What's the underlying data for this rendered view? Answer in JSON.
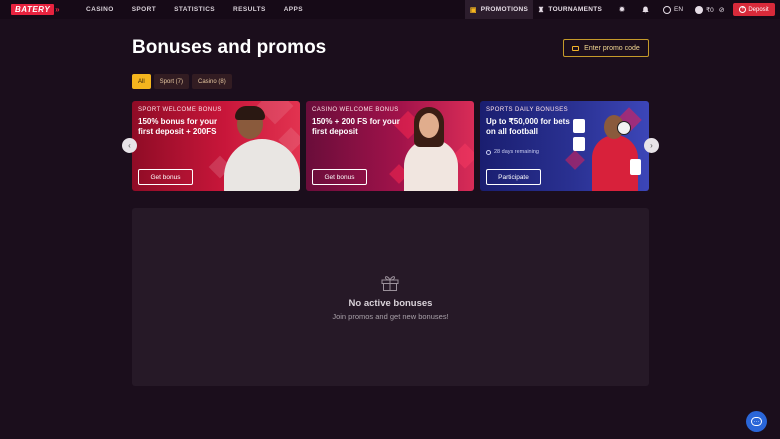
{
  "brand": {
    "name": "BATERY",
    "arrows": "»",
    "accent": "#e8233f"
  },
  "nav": {
    "items": [
      "CASINO",
      "SPORT",
      "STATISTICS",
      "RESULTS",
      "APPS"
    ]
  },
  "header": {
    "promotions": "PROMOTIONS",
    "tournaments": "TOURNAMENTS",
    "lang": "EN",
    "balance": "₹0",
    "deposit": "Deposit"
  },
  "page": {
    "title": "Bonuses and promos",
    "promo_code": "Enter promo code"
  },
  "filters": [
    {
      "label": "All"
    },
    {
      "label": "Sport (7)"
    },
    {
      "label": "Casino (8)"
    }
  ],
  "cards": [
    {
      "kicker": "SPORT WELCOME BONUS",
      "headline": "150% bonus for your first deposit + 200FS",
      "cta": "Get bonus"
    },
    {
      "kicker": "CASINO WELCOME BONUS",
      "headline": "150% + 200 FS for your first deposit",
      "cta": "Get bonus"
    },
    {
      "kicker": "SPORTS DAILY BONUSES",
      "headline": "Up to ₹50,000 for bets on all football",
      "remaining": "28 days remaining",
      "cta": "Participate"
    }
  ],
  "empty": {
    "title": "No active bonuses",
    "subtitle": "Join promos and get new bonuses!"
  },
  "icons": {
    "promotions": "gift-icon",
    "tournaments": "trophy-icon",
    "settings": "gear-icon",
    "notifications": "bell-icon",
    "language": "globe-icon",
    "account": "user-icon",
    "visibility": "eye-slash-icon",
    "deposit": "plus-circle-icon",
    "promo_code": "ticket-icon",
    "carousel_prev": "chevron-left-icon",
    "carousel_next": "chevron-right-icon",
    "empty_state": "gift-icon",
    "chat": "chat-icon",
    "remaining": "clock-icon"
  },
  "colors": {
    "primary": "#f5b51e",
    "deposit": "#d82a3a",
    "background": "#1b0e1c"
  }
}
